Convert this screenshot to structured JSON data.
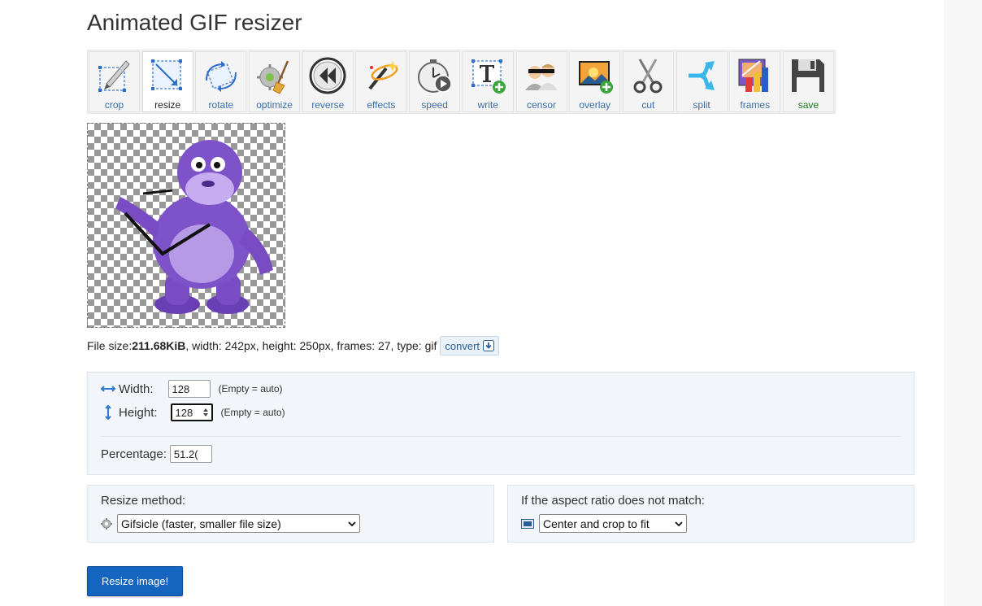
{
  "page": {
    "title": "Animated GIF resizer"
  },
  "toolbar": {
    "items": [
      {
        "id": "crop",
        "label": "crop",
        "icon": "crop-icon"
      },
      {
        "id": "resize",
        "label": "resize",
        "icon": "resize-icon",
        "active": true
      },
      {
        "id": "rotate",
        "label": "rotate",
        "icon": "rotate-icon"
      },
      {
        "id": "optimize",
        "label": "optimize",
        "icon": "optimize-icon"
      },
      {
        "id": "reverse",
        "label": "reverse",
        "icon": "reverse-icon"
      },
      {
        "id": "effects",
        "label": "effects",
        "icon": "effects-icon"
      },
      {
        "id": "speed",
        "label": "speed",
        "icon": "speed-icon"
      },
      {
        "id": "write",
        "label": "write",
        "icon": "write-icon"
      },
      {
        "id": "censor",
        "label": "censor",
        "icon": "censor-icon"
      },
      {
        "id": "overlay",
        "label": "overlay",
        "icon": "overlay-icon"
      },
      {
        "id": "cut",
        "label": "cut",
        "icon": "cut-icon"
      },
      {
        "id": "split",
        "label": "split",
        "icon": "split-icon"
      },
      {
        "id": "frames",
        "label": "frames",
        "icon": "frames-icon"
      },
      {
        "id": "save",
        "label": "save",
        "icon": "save-icon"
      }
    ]
  },
  "fileinfo": {
    "size_label": "File size: ",
    "size_value": "211.68KiB",
    "rest": ", width: 242px, height: 250px, frames: 27, type: gif",
    "convert_label": "convert"
  },
  "dimensions": {
    "width_label": "Width:",
    "width_value": "128",
    "width_hint": "(Empty = auto)",
    "height_label": "Height:",
    "height_value": "128",
    "height_hint": "(Empty = auto)",
    "percentage_label": "Percentage:",
    "percentage_value": "51.2("
  },
  "method": {
    "title": "Resize method:",
    "selected": "Gifsicle (faster, smaller file size)"
  },
  "aspect": {
    "title": "If the aspect ratio does not match:",
    "selected": "Center and crop to fit"
  },
  "actions": {
    "resize_label": "Resize image!"
  },
  "colors": {
    "primary_button": "#1565c0",
    "panel_bg": "#f2f6fa",
    "tool_label": "#3a6ea5",
    "save_label": "#1a7a1a"
  }
}
